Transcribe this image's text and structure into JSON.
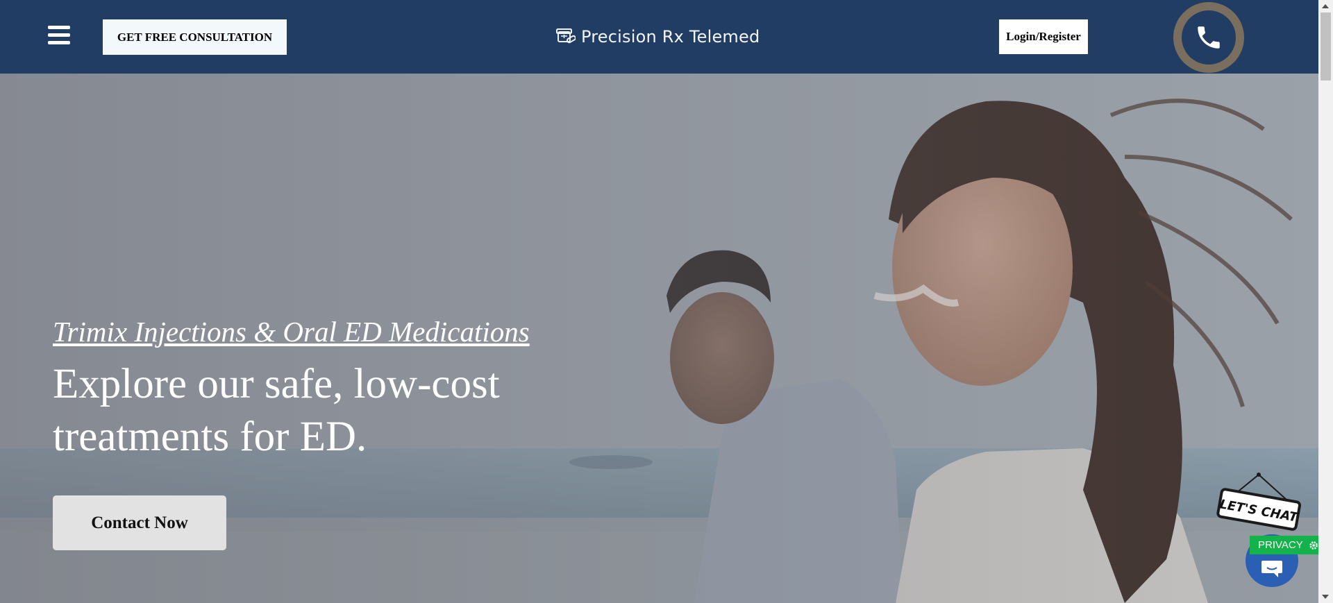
{
  "header": {
    "menu_icon": "hamburger-menu-icon",
    "consultation_label": "GET FREE CONSULTATION",
    "brand_name": "Precision Rx Telemed",
    "login_label": "Login/Register",
    "phone_icon": "phone-icon"
  },
  "hero": {
    "subtitle": "Trimix Injections & Oral ED Medications",
    "title": "Explore our safe, low-cost treatments for ED.",
    "cta_label": "Contact Now"
  },
  "widgets": {
    "chat_sign_label": "LET'S CHAT",
    "privacy_label": "PRIVACY",
    "privacy_icon": "gear-icon",
    "chat_icon": "chat-bubble-icon"
  },
  "colors": {
    "header_bg": "#223d63",
    "phone_ring": "#7a6e5e",
    "privacy_green": "#13b24a",
    "chat_blue": "#2a5fb3"
  }
}
